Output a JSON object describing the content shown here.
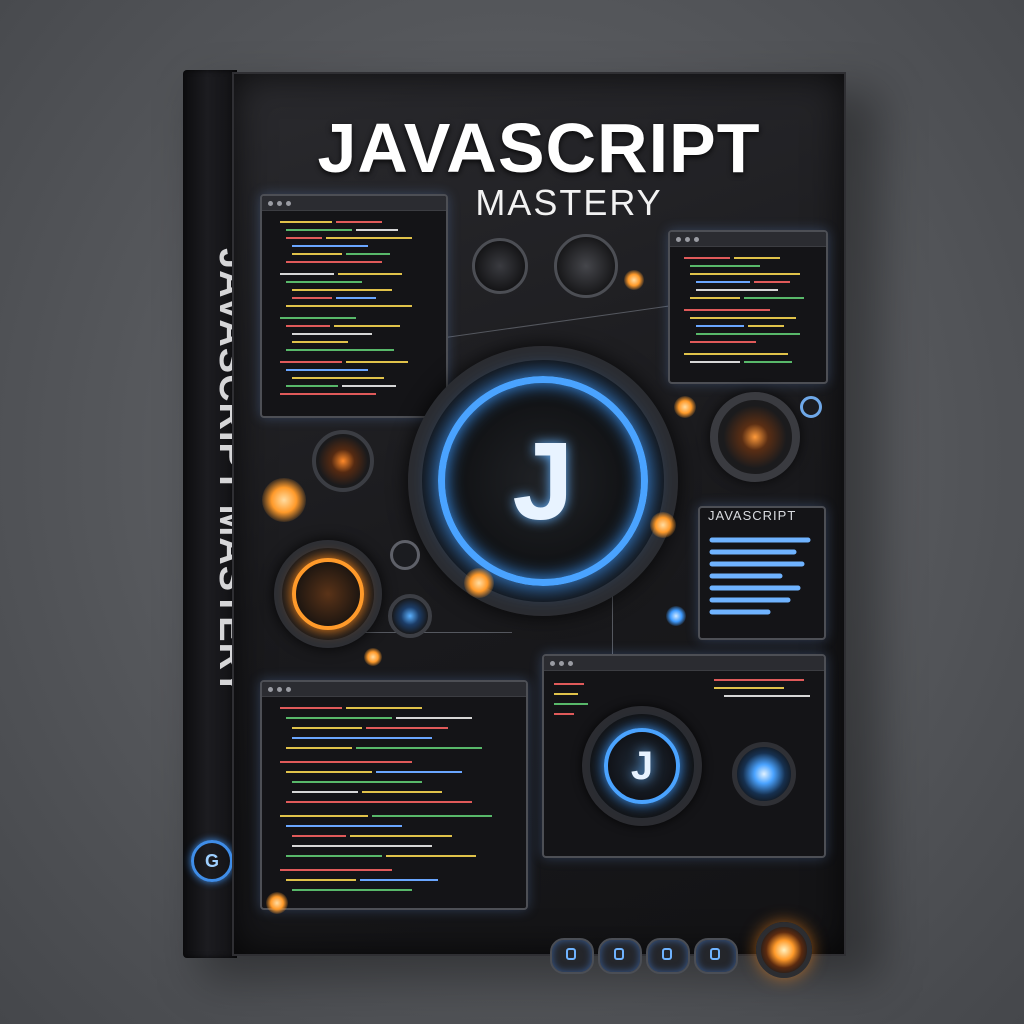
{
  "cover": {
    "title": "JAVASCRIPT",
    "subtitle": "MASTERY",
    "spine_title": "JAVASCRIPT MASTERY",
    "center_logo": "J",
    "right_panel_label": "JAVASCRIPT",
    "lower_logo": "J",
    "spine_logo": "G"
  },
  "colors": {
    "accent_blue": "#3f9bff",
    "accent_orange": "#ff9a2a",
    "cover_bg": "#1a1a1d",
    "background": "#55575b"
  },
  "icons": [
    "code-window-icon",
    "glowing-orb-icon",
    "dial-icon",
    "button-icon"
  ]
}
